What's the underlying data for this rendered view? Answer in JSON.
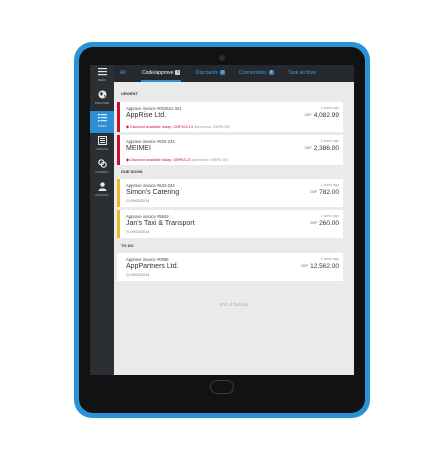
{
  "sidebar": {
    "items": [
      {
        "icon": "menu-icon",
        "label": "MENU"
      },
      {
        "icon": "globe-icon",
        "label": "DISCOVER"
      },
      {
        "icon": "tasks-icon",
        "label": "TASKS"
      },
      {
        "icon": "catalog-icon",
        "label": "CATALOG"
      },
      {
        "icon": "link-icon",
        "label": "CONNECT"
      },
      {
        "icon": "user-icon",
        "label": "ACCOUNT"
      }
    ],
    "active_index": 2
  },
  "tabs": [
    {
      "label": "All",
      "count": ""
    },
    {
      "label": "Code/approve",
      "count": "5"
    },
    {
      "label": "Discounts",
      "count": "2"
    },
    {
      "label": "Connections",
      "count": "3"
    },
    {
      "label": "Task archive",
      "count": ""
    }
  ],
  "sections": {
    "urgent": "URGENT",
    "due_soon": "DUE SOON",
    "to_do": "TO DO"
  },
  "cards": [
    {
      "title": "Approve invoice #002521-341",
      "name": "AppRise Ltd.",
      "ago": "1 week ago",
      "currency": "GBP",
      "amount": "4,082.99",
      "discount_red": "Discount available today: GBP103.13",
      "discount_rest": " (tomorrow: GBP6.06)"
    },
    {
      "title": "Approve invoice #632-234",
      "name": "MEIMEI",
      "ago": "1 week ago",
      "currency": "GBP",
      "amount": "2,386.00",
      "discount_red": "Discount available today: GBP63.23",
      "discount_rest": " (tomorrow: GBP5.06)"
    },
    {
      "title": "Approve invoice #632-234",
      "name": "Simon's Catering",
      "ago": "1 week ago",
      "currency": "GBP",
      "amount": "782.00",
      "date": "09/02/2014"
    },
    {
      "title": "Approve invoice #5642",
      "name": "Jan's Taxi & Transport",
      "ago": "1 week ago",
      "currency": "GBP",
      "amount": "260.00",
      "date": "09/22/2014"
    },
    {
      "title": "Approve invoice #0056",
      "name": "AppPartners Ltd.",
      "ago": "1 week ago",
      "currency": "GBP",
      "amount": "12,562.00",
      "date": "09/22/2014"
    }
  ],
  "footer": "End of Todo list",
  "colors": {
    "accent": "#2d8fd6",
    "tablet_frame": "#2a93d5",
    "urgent": "#c8102e",
    "due_soon": "#f0b429"
  }
}
